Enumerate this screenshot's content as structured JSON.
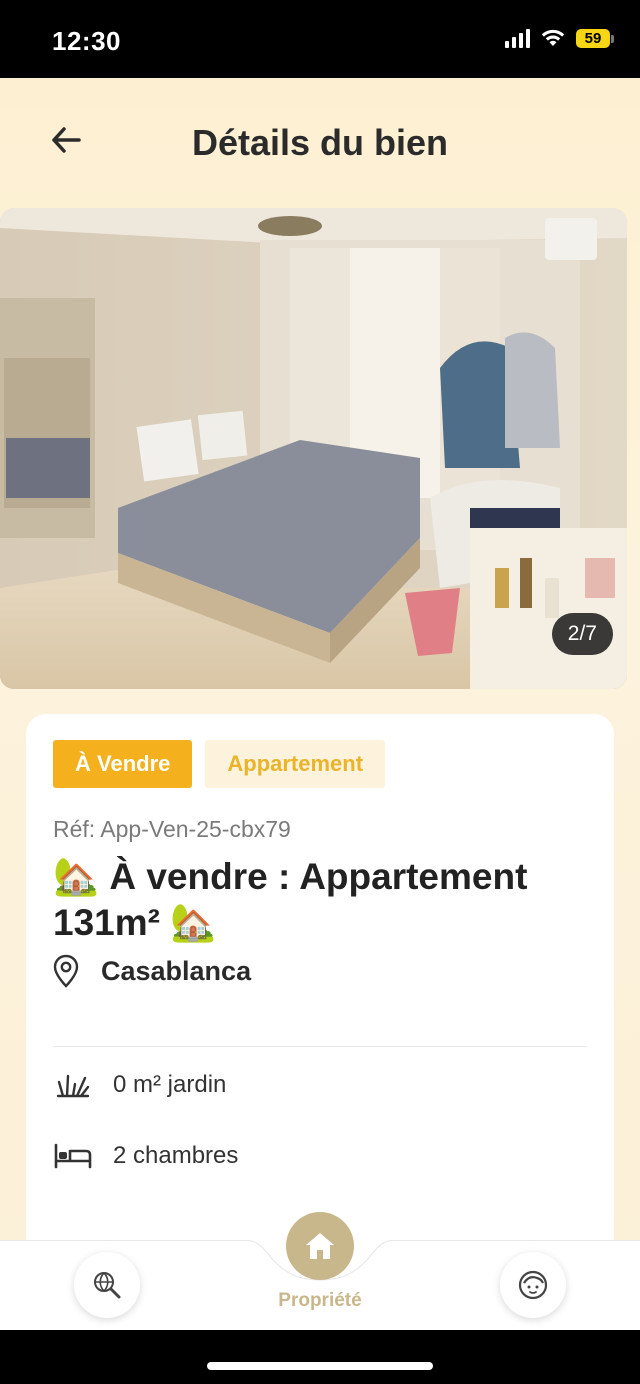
{
  "status_bar": {
    "time": "12:30",
    "battery": "59",
    "battery_color": "#f5d514"
  },
  "header": {
    "back_icon": "arrow-left-icon",
    "title": "Détails du bien"
  },
  "gallery": {
    "counter": "2/7",
    "current": 2,
    "total": 7
  },
  "listing": {
    "tag_sale": "À Vendre",
    "tag_type": "Appartement",
    "reference": "Réf: App-Ven-25-cbx79",
    "title": "🏡 À vendre : Appartement 131m² 🏡",
    "location_icon": "map-pin-icon",
    "location": "Casablanca",
    "features": [
      {
        "icon": "garden-icon",
        "text": "0 m² jardin"
      },
      {
        "icon": "bed-icon",
        "text": "2  chambres"
      }
    ]
  },
  "bottom_nav": {
    "left_icon": "globe-search-icon",
    "center_icon": "home-icon",
    "center_label": "Propriété",
    "right_icon": "profile-face-icon",
    "accent_color": "#c9b78c"
  },
  "colors": {
    "tag_sale_bg": "#f4b11d",
    "tag_type_bg": "#fdf3dc",
    "tag_type_text": "#ebb32a"
  }
}
